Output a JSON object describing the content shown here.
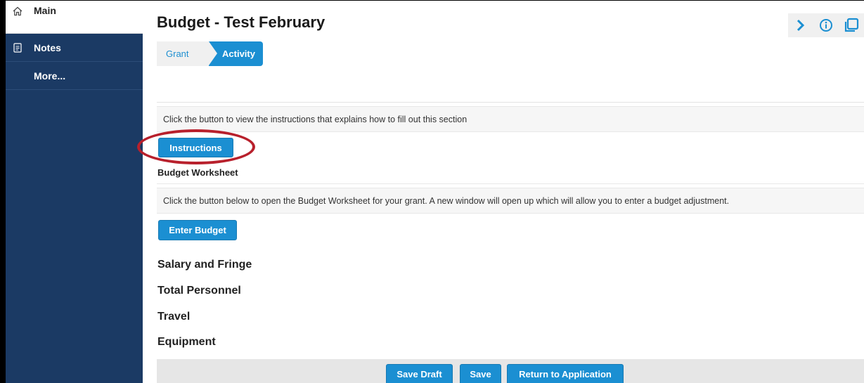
{
  "sidebar": {
    "items": [
      {
        "label": "Main",
        "icon": "home-icon"
      },
      {
        "label": "Notes",
        "icon": "document-icon"
      },
      {
        "label": "More...",
        "icon": ""
      }
    ]
  },
  "page": {
    "title": "Budget - Test February",
    "tabs": [
      "Grant",
      "Activity"
    ],
    "active_tab": "Activity"
  },
  "top_icons": [
    "chevron-right-icon",
    "info-icon",
    "copy-icon"
  ],
  "instructions": {
    "text": "Click the button to view the instructions that explains how to fill out this section",
    "button": "Instructions"
  },
  "worksheet": {
    "heading": "Budget Worksheet",
    "text": "Click the button below to open the Budget Worksheet for your grant. A new window will open up which will allow you to enter a budget adjustment.",
    "button": "Enter Budget"
  },
  "sections": [
    "Salary and Fringe",
    "Total Personnel",
    "Travel",
    "Equipment"
  ],
  "footer": {
    "buttons": [
      "Save Draft",
      "Save",
      "Return to Application"
    ]
  },
  "colors": {
    "sidebar": "#1b3a64",
    "accent": "#1b8fd2",
    "highlight_oval": "#b8202c"
  }
}
